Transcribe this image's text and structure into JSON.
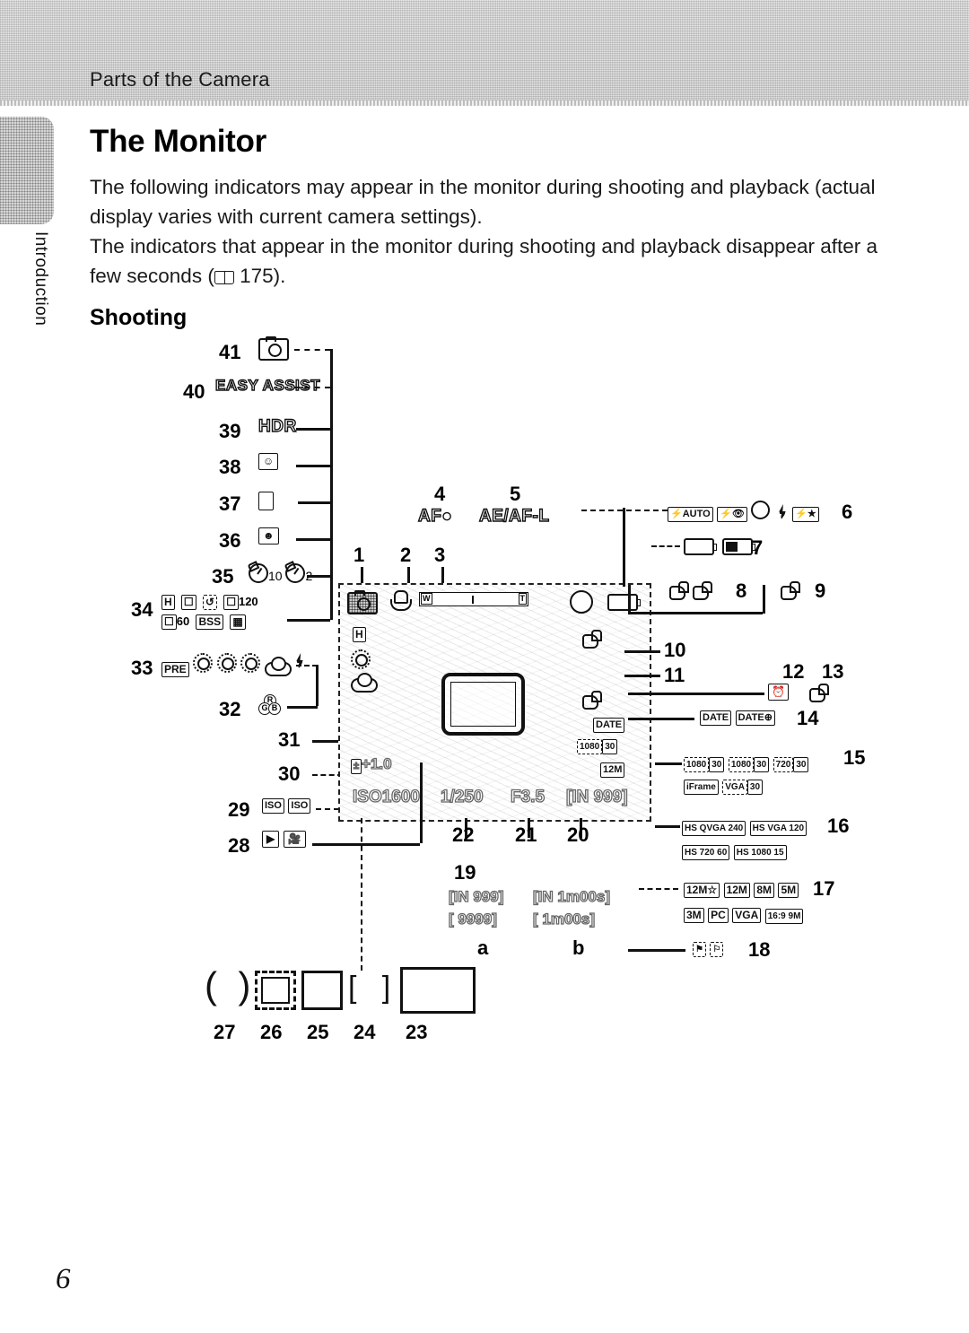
{
  "header": {
    "section_title": "Parts of the Camera"
  },
  "side_tab": {
    "label": "Introduction"
  },
  "content": {
    "heading": "The Monitor",
    "paragraph_1": "The following indicators may appear in the monitor during shooting and playback (actual display varies with current camera settings).",
    "paragraph_2_before": "The indicators that appear in the monitor during shooting and playback disappear after a few seconds (",
    "paragraph_2_ref": "175",
    "paragraph_2_after": ").",
    "subheading": "Shooting"
  },
  "left_callouts": [
    {
      "num": "41",
      "icon": "camera-mode-icon"
    },
    {
      "num": "40",
      "label": "EASY ASSIST"
    },
    {
      "num": "39",
      "label": "HDR"
    },
    {
      "num": "38",
      "icon": "pet-portrait-icon"
    },
    {
      "num": "37",
      "icon": "multi-shot-icon"
    },
    {
      "num": "36",
      "icon": "smile-timer-icon"
    },
    {
      "num": "35",
      "label_a": "10",
      "label_b": "2",
      "icon": "self-timer-icon"
    },
    {
      "num": "34",
      "labels": [
        "H",
        "",
        "",
        "120",
        "60",
        "BSS",
        ""
      ]
    },
    {
      "num": "33",
      "labels": [
        "PRE",
        "",
        "",
        "",
        "",
        ""
      ]
    },
    {
      "num": "32",
      "icon": "rgb-color-options-icon"
    },
    {
      "num": "31",
      "icon": ""
    },
    {
      "num": "30",
      "label": "+1.0"
    },
    {
      "num": "29",
      "labels": [
        "ISO",
        "ISO-A"
      ]
    },
    {
      "num": "28",
      "icon": "playback-movie-icon"
    }
  ],
  "monitor_osd": {
    "item1": "shooting-mode-icon",
    "item2": "macro-mode-icon",
    "item3_zoom": {
      "wide": "W",
      "tele": "T"
    },
    "item4": "AF●",
    "item5": "AE/AF-L",
    "burst_h": "H",
    "exposure_comp": "+1.0",
    "iso": "ISO1600",
    "shutter": "1/250",
    "aperture": "F3.5",
    "remaining": "[IN 999]",
    "date_imprint": "DATE",
    "movie_opt": "1080 30",
    "image_mode": "12M"
  },
  "right_callouts": [
    {
      "num": "6",
      "labels": [
        "AUTO"
      ],
      "name": "flash-mode"
    },
    {
      "num": "7",
      "name": "battery-level"
    },
    {
      "num": "8",
      "name": "vibration-reduction"
    },
    {
      "num": "9",
      "name": "motion-detection"
    },
    {
      "num": "10",
      "name": "wind-noise-reduction"
    },
    {
      "num": "11",
      "name": "blink-warning"
    },
    {
      "num": "12",
      "name": "travel-destination"
    },
    {
      "num": "13",
      "name": "touch-shutter"
    },
    {
      "num": "14",
      "labels": [
        "DATE",
        "DATE⊕"
      ],
      "name": "date-imprint"
    },
    {
      "num": "15",
      "labels": [
        "1080 30",
        "1080 30",
        "720 30",
        "iFrame",
        "VGA 30"
      ],
      "name": "movie-options"
    },
    {
      "num": "16",
      "labels": [
        "HS QVGA 240",
        "HS VGA 120",
        "HS 720 60",
        "HS 1080 15"
      ],
      "name": "hs-movie-options"
    },
    {
      "num": "17",
      "labels": [
        "12M☆",
        "12M",
        "8M",
        "5M",
        "3M",
        "PC",
        "VGA",
        "16:9 9M"
      ],
      "name": "image-mode"
    },
    {
      "num": "18",
      "name": "panorama-assist"
    }
  ],
  "bottom_callouts": [
    {
      "num": "22",
      "name": "shutter-speed"
    },
    {
      "num": "21",
      "name": "aperture-value"
    },
    {
      "num": "20",
      "name": "exposures-remaining"
    },
    {
      "num": "19",
      "name": "internal-memory-indicator",
      "rows": [
        {
          "a": "[IN 999]",
          "b": "[IN      1m00s]"
        },
        {
          "a": "[ 9999]",
          "b": "[        1m00s]"
        }
      ],
      "sub_a": "a",
      "sub_b": "b"
    }
  ],
  "focus_markers": [
    {
      "num": "27",
      "shape": "parentheses"
    },
    {
      "num": "26",
      "shape": "bracketed-square"
    },
    {
      "num": "25",
      "shape": "square"
    },
    {
      "num": "24",
      "shape": "corner-brackets"
    },
    {
      "num": "23",
      "shape": "rectangle"
    }
  ],
  "footer": {
    "page_number": "6"
  }
}
